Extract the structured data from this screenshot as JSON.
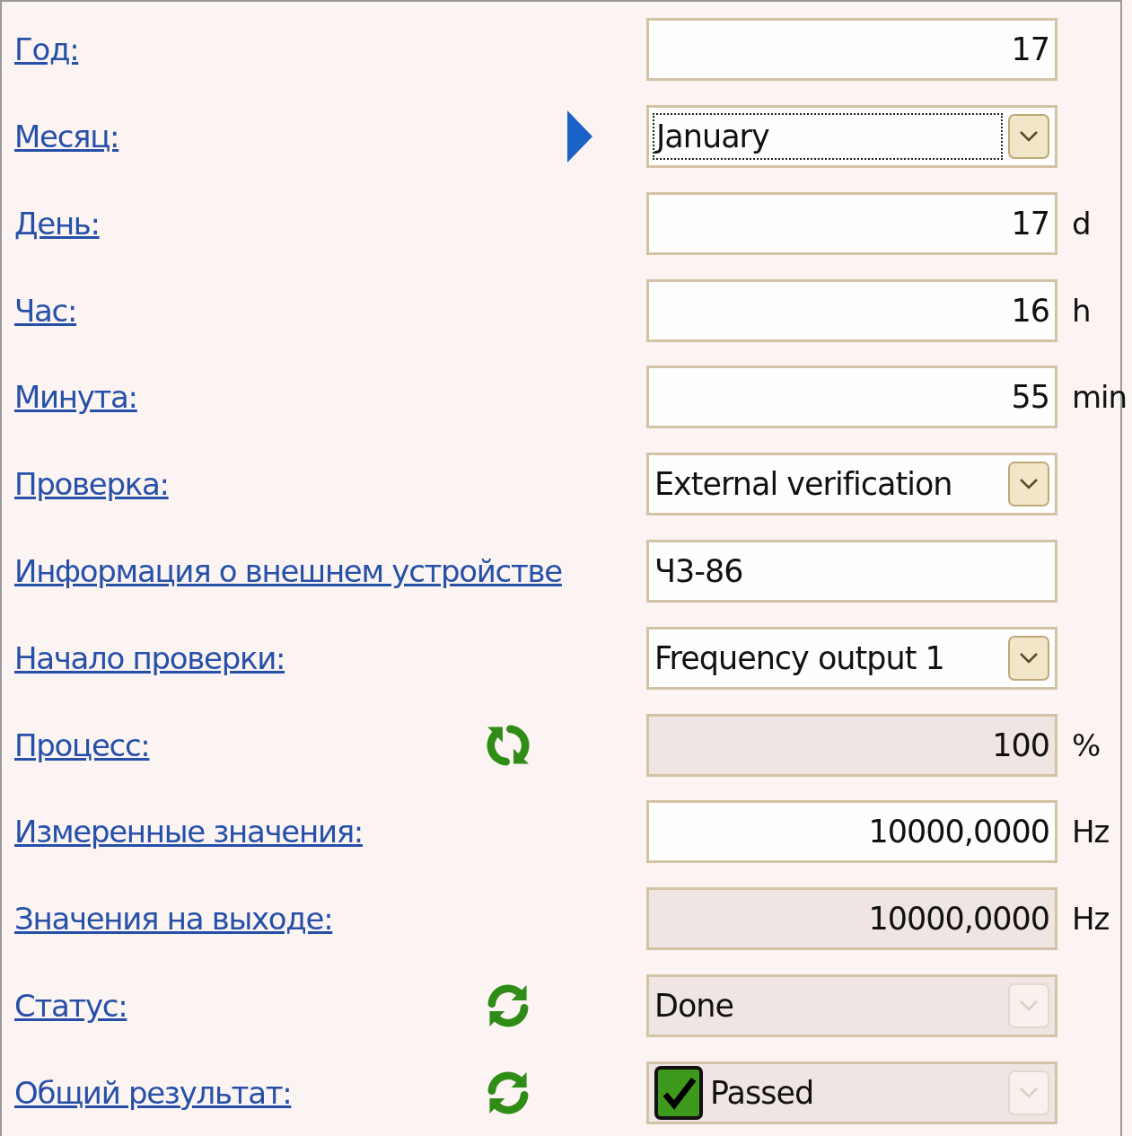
{
  "fields": [
    {
      "label": "Год:",
      "kind": "number",
      "value": "17",
      "disabled": false
    },
    {
      "label": "Месяц:",
      "kind": "combo",
      "value": "January",
      "disabled": false,
      "focused": true,
      "indicator": {
        "kind": "arrow"
      }
    },
    {
      "label": "День:",
      "kind": "number",
      "value": "17",
      "disabled": false,
      "unit": "d"
    },
    {
      "label": "Час:",
      "kind": "number",
      "value": "16",
      "disabled": false,
      "unit": "h"
    },
    {
      "label": "Минута:",
      "kind": "number",
      "value": "55",
      "disabled": false,
      "unit": "min"
    },
    {
      "label": "Проверка:",
      "kind": "combo",
      "value": "External verification",
      "disabled": false
    },
    {
      "label": "Информация о внешнем устройстве",
      "kind": "text",
      "value": "Ч3-86",
      "disabled": false
    },
    {
      "label": "Начало проверки:",
      "kind": "combo",
      "value": "Frequency output 1",
      "disabled": false
    },
    {
      "label": "Процесс:",
      "kind": "number",
      "value": "100",
      "disabled": true,
      "unit": "%",
      "indicator": {
        "kind": "refresh-vertical"
      }
    },
    {
      "label": "Измеренные значения:",
      "kind": "number",
      "value": "10000,0000",
      "disabled": false,
      "unit": "Hz"
    },
    {
      "label": "Значения на выходе:",
      "kind": "number",
      "value": "10000,0000",
      "disabled": true,
      "unit": "Hz"
    },
    {
      "label": "Статус:",
      "kind": "combo",
      "value": "Done",
      "disabled": true,
      "indicator": {
        "kind": "refresh"
      }
    },
    {
      "label": "Общий результат:",
      "kind": "check-combo",
      "value": "Passed",
      "checked": true,
      "disabled": true,
      "indicator": {
        "kind": "refresh"
      }
    }
  ]
}
